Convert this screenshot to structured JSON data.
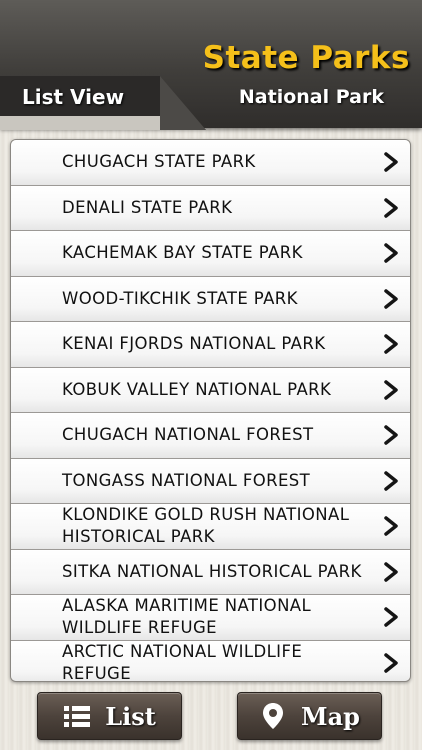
{
  "header": {
    "title": "State Parks",
    "subtitle": "National Park",
    "tab_label": "List View"
  },
  "list": {
    "items": [
      {
        "label": "CHUGACH STATE PARK"
      },
      {
        "label": "DENALI STATE PARK"
      },
      {
        "label": "KACHEMAK BAY STATE PARK"
      },
      {
        "label": "WOOD-TIKCHIK STATE PARK"
      },
      {
        "label": "KENAI FJORDS NATIONAL PARK"
      },
      {
        "label": "KOBUK VALLEY NATIONAL PARK"
      },
      {
        "label": "CHUGACH NATIONAL FOREST"
      },
      {
        "label": "TONGASS NATIONAL FOREST"
      },
      {
        "label": "KLONDIKE GOLD RUSH NATIONAL HISTORICAL PARK"
      },
      {
        "label": "SITKA NATIONAL HISTORICAL PARK"
      },
      {
        "label": "ALASKA MARITIME NATIONAL WILDLIFE REFUGE"
      },
      {
        "label": "ARCTIC NATIONAL WILDLIFE REFUGE"
      }
    ],
    "row_icon": "chevron-right-icon"
  },
  "toolbar": {
    "list_label": "List",
    "list_icon": "list-icon",
    "map_label": "Map",
    "map_icon": "map-pin-icon"
  },
  "colors": {
    "title": "#f5c01a",
    "header_bg": "#403e3b",
    "button_bg": "#4d433c"
  }
}
